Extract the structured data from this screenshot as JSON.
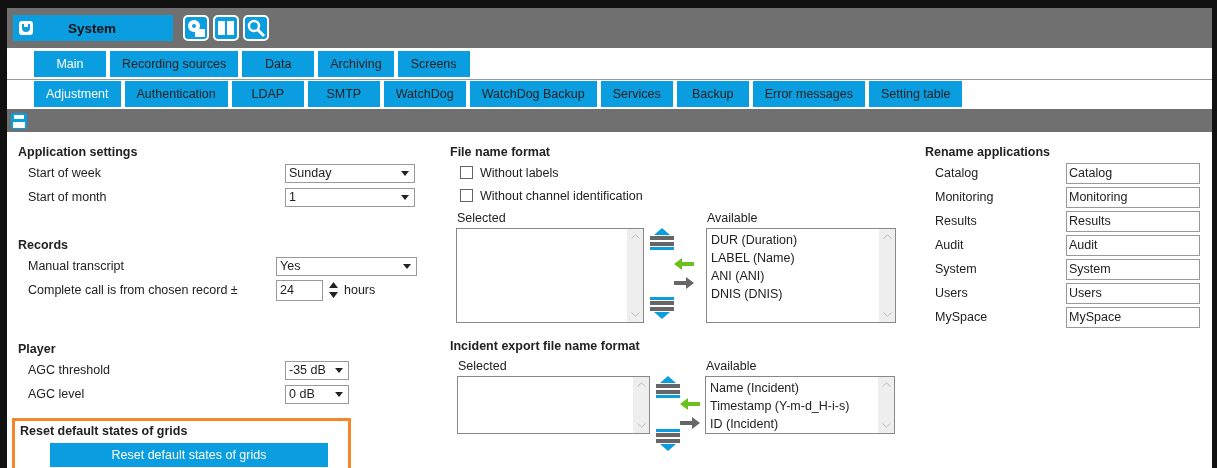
{
  "header": {
    "title": "System"
  },
  "tab_rows": [
    [
      {
        "label": "Main",
        "selected": true
      },
      {
        "label": "Recording sources",
        "selected": false
      },
      {
        "label": "Data",
        "selected": false
      },
      {
        "label": "Archiving",
        "selected": false
      },
      {
        "label": "Screens",
        "selected": false
      }
    ],
    [
      {
        "label": "Adjustment",
        "selected": true
      },
      {
        "label": "Authentication",
        "selected": false
      },
      {
        "label": "LDAP",
        "selected": false
      },
      {
        "label": "SMTP",
        "selected": false
      },
      {
        "label": "WatchDog",
        "selected": false
      },
      {
        "label": "WatchDog Backup",
        "selected": false
      },
      {
        "label": "Services",
        "selected": false
      },
      {
        "label": "Backup",
        "selected": false
      },
      {
        "label": "Error messages",
        "selected": false
      },
      {
        "label": "Setting table",
        "selected": false
      }
    ]
  ],
  "left_sections": [
    {
      "title": "Application settings",
      "rows": [
        {
          "kind": "select",
          "label": "Start of week",
          "value": "Sunday"
        },
        {
          "kind": "select",
          "label": "Start of month",
          "value": "1"
        }
      ]
    },
    {
      "title": "Records",
      "rows": [
        {
          "kind": "select",
          "label": "Manual transcript",
          "value": "Yes"
        },
        {
          "kind": "spinner",
          "label": "Complete call is from chosen record ±",
          "value": "24",
          "unit": "hours"
        }
      ]
    },
    {
      "title": "Player",
      "rows": [
        {
          "kind": "small_select",
          "label": "AGC threshold",
          "value": "-35 dB"
        },
        {
          "kind": "small_select",
          "label": "AGC level",
          "value": "0 dB"
        }
      ]
    }
  ],
  "reset_section": {
    "title": "Reset default states of grids",
    "button": "Reset default states of grids",
    "highlighted": true
  },
  "file_name_format": {
    "title": "File name format",
    "checkboxes": [
      {
        "label": "Without labels",
        "checked": false
      },
      {
        "label": "Without channel identification",
        "checked": false
      }
    ],
    "selected_label": "Selected",
    "available_label": "Available",
    "available_items": [
      "DUR (Duration)",
      "LABEL (Name)",
      "ANI (ANI)",
      "DNIS (DNIS)"
    ]
  },
  "incident_export_format": {
    "title": "Incident export file name format",
    "selected_label": "Selected",
    "available_label": "Available",
    "available_items": [
      "Name (Incident)",
      "Timestamp (Y-m-d_H-i-s)",
      "ID (Incident)"
    ]
  },
  "rename_applications": {
    "title": "Rename applications",
    "rows": [
      {
        "label": "Catalog",
        "value": "Catalog"
      },
      {
        "label": "Monitoring",
        "value": "Monitoring"
      },
      {
        "label": "Results",
        "value": "Results"
      },
      {
        "label": "Audit",
        "value": "Audit"
      },
      {
        "label": "System",
        "value": "System"
      },
      {
        "label": "Users",
        "value": "Users"
      },
      {
        "label": "MySpace",
        "value": "MySpace"
      }
    ]
  }
}
